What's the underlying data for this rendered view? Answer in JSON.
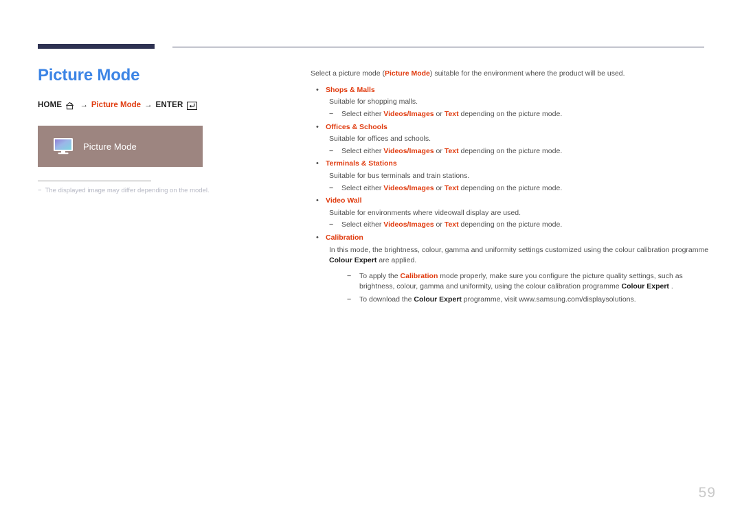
{
  "page": {
    "number": "59",
    "title": "Picture Mode"
  },
  "nav_path": {
    "home_label": "HOME",
    "home_icon": "home-icon",
    "arrow": "→",
    "middle_label": "Picture Mode",
    "enter_label": "ENTER",
    "enter_icon": "enter-key-icon"
  },
  "illustration": {
    "icon": "monitor-icon",
    "label": "Picture Mode",
    "background_color": "#9d8580"
  },
  "note": {
    "dash": "−",
    "text": "The displayed image may differ depending on the model."
  },
  "colors": {
    "title_blue": "#3d85e5",
    "accent_red": "#e03c10",
    "rule_navy": "#2e3252",
    "page_number_gray": "#c9c9c9"
  },
  "content": {
    "intro": {
      "part1": "Select a picture mode (",
      "bold1": "Picture Mode",
      "part2": ") suitable for the environment where the product will be used."
    },
    "bullet_char": "•",
    "dash_char": "−",
    "modes": [
      {
        "title": "Shops & Malls",
        "description": "Suitable for shopping malls.",
        "sub": [
          {
            "pre": "Select either ",
            "b1": "Videos/Images",
            "mid": " or ",
            "b2": "Text",
            "post": " depending on the picture mode."
          }
        ]
      },
      {
        "title": "Offices & Schools",
        "description": "Suitable for offices and schools.",
        "sub": [
          {
            "pre": "Select either ",
            "b1": "Videos/Images",
            "mid": " or ",
            "b2": "Text",
            "post": " depending on the picture mode."
          }
        ]
      },
      {
        "title": "Terminals & Stations",
        "description": "Suitable for bus terminals and train stations.",
        "sub": [
          {
            "pre": "Select either ",
            "b1": "Videos/Images",
            "mid": " or ",
            "b2": "Text",
            "post": " depending on the picture mode."
          }
        ]
      },
      {
        "title": "Video Wall",
        "description": "Suitable for environments where videowall display are used.",
        "sub": [
          {
            "pre": "Select either ",
            "b1": "Videos/Images",
            "mid": " or ",
            "b2": "Text",
            "post": " depending on the picture mode."
          }
        ]
      }
    ],
    "calibration": {
      "title": "Calibration",
      "desc_part1": "In this mode, the brightness, colour, gamma and uniformity settings customized using the colour calibration programme ",
      "desc_bold": "Colour Expert",
      "desc_part2": " are applied.",
      "notes": [
        {
          "pre": "To apply the ",
          "red": "Calibration",
          "mid": " mode properly, make sure you configure the picture quality settings, such as brightness, colour, gamma and uniformity, using the colour calibration programme ",
          "bold": "Colour Expert",
          "post": " ."
        },
        {
          "pre": "To download the ",
          "bold": "Colour Expert",
          "post": " programme, visit www.samsung.com/displaysolutions."
        }
      ]
    }
  }
}
